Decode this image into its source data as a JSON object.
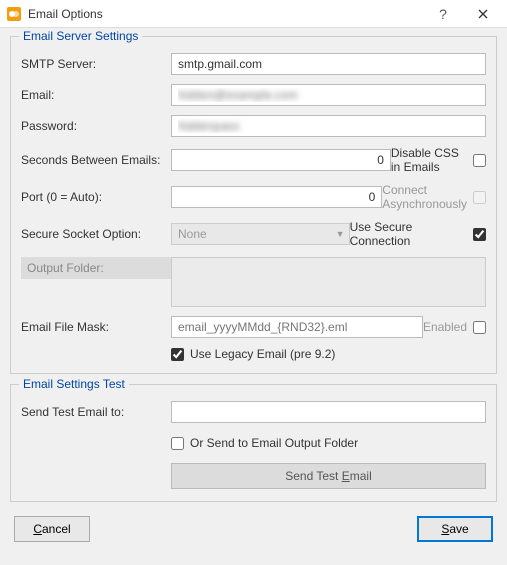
{
  "window": {
    "title": "Email Options"
  },
  "server": {
    "legend": "Email Server Settings",
    "smtp": {
      "label": "SMTP Server:",
      "value": "smtp.gmail.com"
    },
    "email": {
      "label": "Email:",
      "value": "hidden@example.com"
    },
    "password": {
      "label": "Password:",
      "value": "hiddenpass"
    },
    "seconds": {
      "label": "Seconds Between Emails:",
      "value": "0"
    },
    "port": {
      "label": "Port (0 = Auto):",
      "value": "0"
    },
    "secure_option": {
      "label": "Secure Socket Option:",
      "value": "None"
    },
    "output_folder": {
      "label": "Output Folder:"
    },
    "file_mask": {
      "label": "Email File Mask:",
      "placeholder": "email_yyyyMMdd_{RND32}.eml"
    },
    "disable_css": {
      "label": "Disable CSS in Emails",
      "checked": false
    },
    "connect_async": {
      "label": "Connect Asynchronously",
      "checked": false
    },
    "use_secure": {
      "label": "Use Secure Connection",
      "checked": true
    },
    "mask_enabled": {
      "label": "Enabled",
      "checked": false
    },
    "use_legacy": {
      "label": "Use Legacy Email (pre 9.2)",
      "checked": true
    }
  },
  "test": {
    "legend": "Email Settings Test",
    "sendto": {
      "label": "Send Test Email to:",
      "value": ""
    },
    "or_folder": {
      "label": "Or Send to Email Output Folder",
      "checked": false
    },
    "send_pre": "Send Test ",
    "send_key": "E",
    "send_post": "mail"
  },
  "buttons": {
    "cancel_key": "C",
    "cancel_post": "ancel",
    "save_key": "S",
    "save_post": "ave"
  }
}
